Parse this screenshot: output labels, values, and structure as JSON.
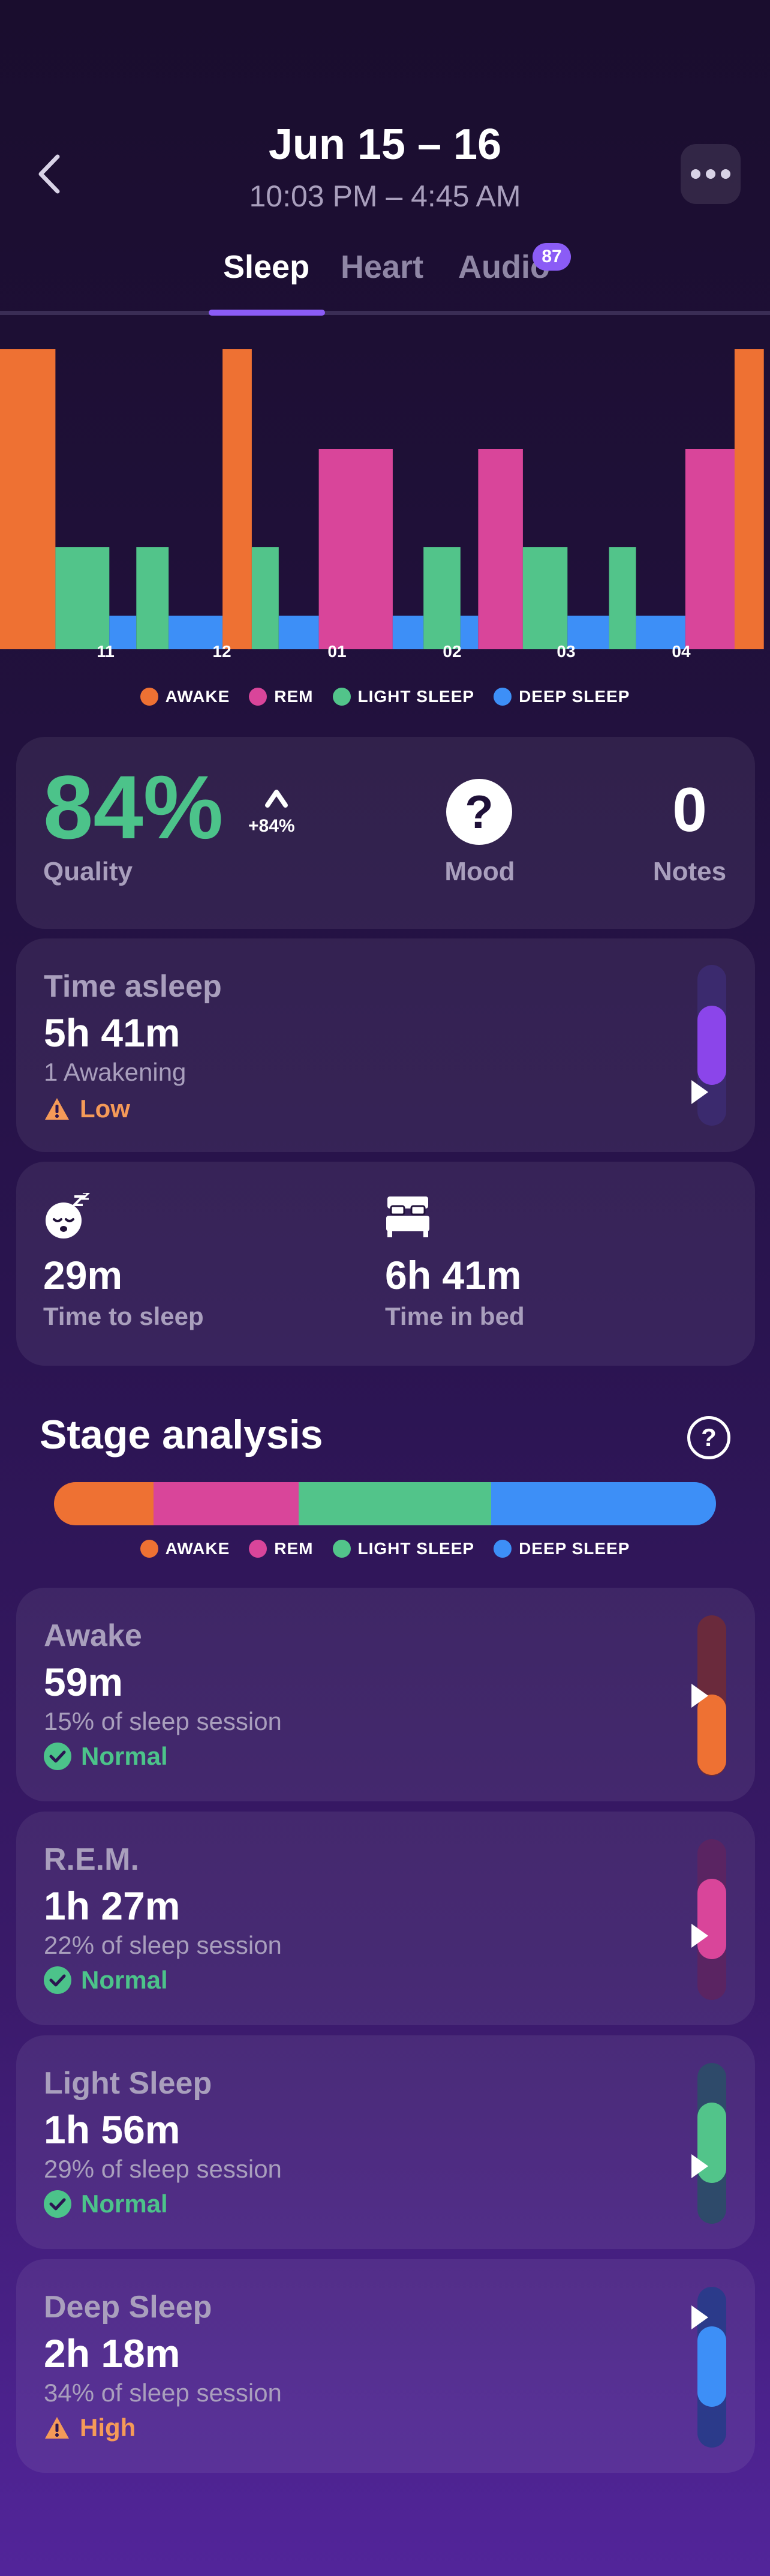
{
  "header": {
    "date": "Jun 15 – 16",
    "time_range": "10:03 PM – 4:45 AM"
  },
  "tabs": [
    {
      "label": "Sleep",
      "active": true
    },
    {
      "label": "Heart",
      "active": false
    },
    {
      "label": "Audio",
      "active": false,
      "badge": "87"
    }
  ],
  "colors": {
    "awake": "#ee7133",
    "rem": "#d9459a",
    "light": "#52c48a",
    "deep": "#3d8ff7",
    "accent": "#8b5cf6"
  },
  "hypnogram": {
    "hour_labels": [
      "11",
      "12",
      "01",
      "02",
      "03",
      "04"
    ],
    "segments": [
      {
        "stage": "awake",
        "duration_fraction": 0.072
      },
      {
        "stage": "light",
        "duration_fraction": 0.07
      },
      {
        "stage": "deep",
        "duration_fraction": 0.035
      },
      {
        "stage": "light",
        "duration_fraction": 0.042
      },
      {
        "stage": "deep",
        "duration_fraction": 0.07
      },
      {
        "stage": "awake",
        "duration_fraction": 0.038
      },
      {
        "stage": "light",
        "duration_fraction": 0.035
      },
      {
        "stage": "deep",
        "duration_fraction": 0.052
      },
      {
        "stage": "rem",
        "duration_fraction": 0.096
      },
      {
        "stage": "deep",
        "duration_fraction": 0.04
      },
      {
        "stage": "light",
        "duration_fraction": 0.048
      },
      {
        "stage": "deep",
        "duration_fraction": 0.023
      },
      {
        "stage": "rem",
        "duration_fraction": 0.058
      },
      {
        "stage": "light",
        "duration_fraction": 0.058
      },
      {
        "stage": "deep",
        "duration_fraction": 0.054
      },
      {
        "stage": "light",
        "duration_fraction": 0.035
      },
      {
        "stage": "deep",
        "duration_fraction": 0.064
      },
      {
        "stage": "rem",
        "duration_fraction": 0.064
      },
      {
        "stage": "awake",
        "duration_fraction": 0.038
      }
    ]
  },
  "legend": [
    {
      "key": "awake",
      "label": "AWAKE"
    },
    {
      "key": "rem",
      "label": "REM"
    },
    {
      "key": "light",
      "label": "LIGHT SLEEP"
    },
    {
      "key": "deep",
      "label": "DEEP SLEEP"
    }
  ],
  "quality": {
    "value": "84%",
    "label": "Quality",
    "delta": "+84%",
    "mood_icon": "?",
    "mood_label": "Mood",
    "notes_value": "0",
    "notes_label": "Notes"
  },
  "time_asleep": {
    "label": "Time asleep",
    "value": "5h 41m",
    "sub": "1 Awakening",
    "status": "Low",
    "status_type": "warning",
    "gauge_level": 0.3
  },
  "time_card": {
    "sleep_icon": "sleeping-face-icon",
    "time_to_sleep_value": "29m",
    "time_to_sleep_label": "Time to sleep",
    "bed_icon": "bed-icon",
    "time_in_bed_value": "6h 41m",
    "time_in_bed_label": "Time in bed"
  },
  "stage_analysis": {
    "title": "Stage analysis",
    "help_icon": "?",
    "bar": [
      {
        "stage": "awake",
        "fraction": 0.15
      },
      {
        "stage": "rem",
        "fraction": 0.22
      },
      {
        "stage": "light",
        "fraction": 0.29
      },
      {
        "stage": "deep",
        "fraction": 0.34
      }
    ]
  },
  "stages": [
    {
      "key": "awake",
      "label": "Awake",
      "value": "59m",
      "sub": "15% of sleep session",
      "status": "Normal",
      "status_type": "ok",
      "gauge_level": 0.5
    },
    {
      "key": "rem",
      "label": "R.E.M.",
      "value": "1h 27m",
      "sub": "22% of sleep session",
      "status": "Normal",
      "status_type": "ok",
      "gauge_level": 0.4
    },
    {
      "key": "light",
      "label": "Light Sleep",
      "value": "1h 56m",
      "sub": "29% of sleep session",
      "status": "Normal",
      "status_type": "ok",
      "gauge_level": 0.35
    },
    {
      "key": "deep",
      "label": "Deep Sleep",
      "value": "2h 18m",
      "sub": "34% of sleep session",
      "status": "High",
      "status_type": "warning",
      "gauge_level": 0.85
    }
  ]
}
